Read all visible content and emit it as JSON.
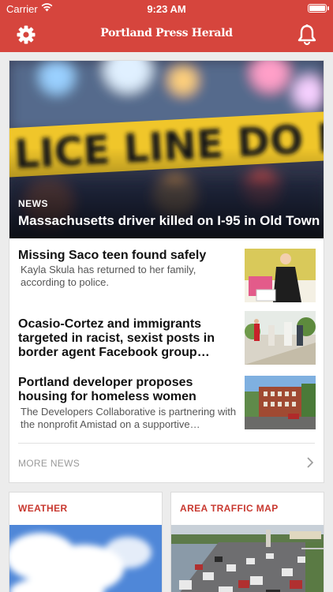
{
  "status_bar": {
    "carrier": "Carrier",
    "time": "9:23 AM"
  },
  "nav": {
    "logo_text": "Portland Press Herald"
  },
  "hero": {
    "kicker": "NEWS",
    "headline": "Massachusetts driver killed on I-95 in Old Town"
  },
  "stories": [
    {
      "title": "Missing Saco teen found safely",
      "summary": "Kayla Skula has returned to her family, according to police."
    },
    {
      "title": "Ocasio-Cortez and immigrants targeted in racist, sexist posts in border agent Facebook group…",
      "summary": ""
    },
    {
      "title": "Portland developer proposes housing for homeless women",
      "summary": "The Developers Collaborative is partnering with the nonprofit Amistad on a supportive…"
    }
  ],
  "more_news_label": "MORE NEWS",
  "weather_label": "WEATHER",
  "traffic_label": "AREA TRAFFIC MAP",
  "colors": {
    "brand_red": "#d6453d",
    "label_red": "#c8382f"
  }
}
